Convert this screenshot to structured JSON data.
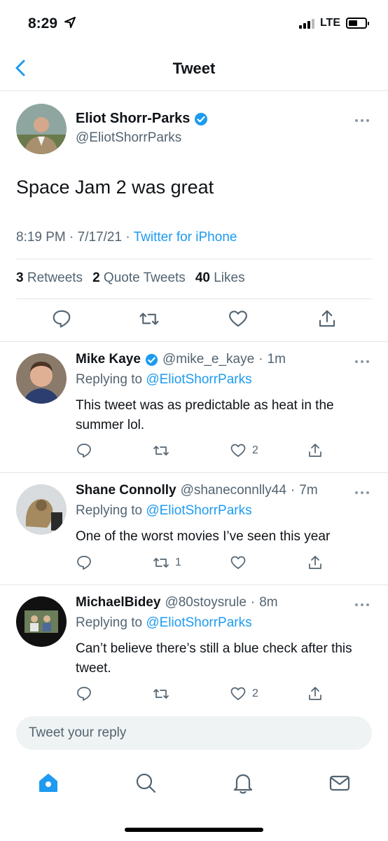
{
  "status": {
    "time": "8:29",
    "network": "LTE"
  },
  "header": {
    "title": "Tweet"
  },
  "tweet": {
    "author_name": "Eliot Shorr-Parks",
    "author_handle": "@EliotShorrParks",
    "text": "Space Jam 2 was great",
    "time": "8:19 PM",
    "date": "7/17/21",
    "source": "Twitter for iPhone",
    "stats": {
      "retweets_count": "3",
      "retweets_label": "Retweets",
      "quotes_count": "2",
      "quotes_label": "Quote Tweets",
      "likes_count": "40",
      "likes_label": "Likes"
    }
  },
  "replies": [
    {
      "name": "Mike Kaye",
      "verified": true,
      "handle": "@mike_e_kaye",
      "time": "1m",
      "replying_label": "Replying to",
      "replying_to": "@EliotShorrParks",
      "text": "This tweet was as predictable as heat in the summer lol.",
      "retweets": "",
      "likes": "2"
    },
    {
      "name": "Shane Connolly",
      "verified": false,
      "handle": "@shaneconnlly44",
      "time": "7m",
      "replying_label": "Replying to",
      "replying_to": "@EliotShorrParks",
      "text": "One of the worst movies I’ve seen this year",
      "retweets": "1",
      "likes": ""
    },
    {
      "name": "MichaelBidey",
      "verified": false,
      "handle": "@80stoysrule",
      "time": "8m",
      "replying_label": "Replying to",
      "replying_to": "@EliotShorrParks",
      "text": "Can’t believe there’s still a blue check after this tweet.",
      "retweets": "",
      "likes": "2"
    }
  ],
  "reply_box": {
    "placeholder": "Tweet your reply"
  },
  "tabs": [
    "home-icon",
    "search-icon",
    "notifications-icon",
    "messages-icon"
  ],
  "colors": {
    "accent": "#1d9bf0",
    "text": "#0f1419",
    "secondary": "#536471",
    "divider": "#e1e5e8"
  }
}
